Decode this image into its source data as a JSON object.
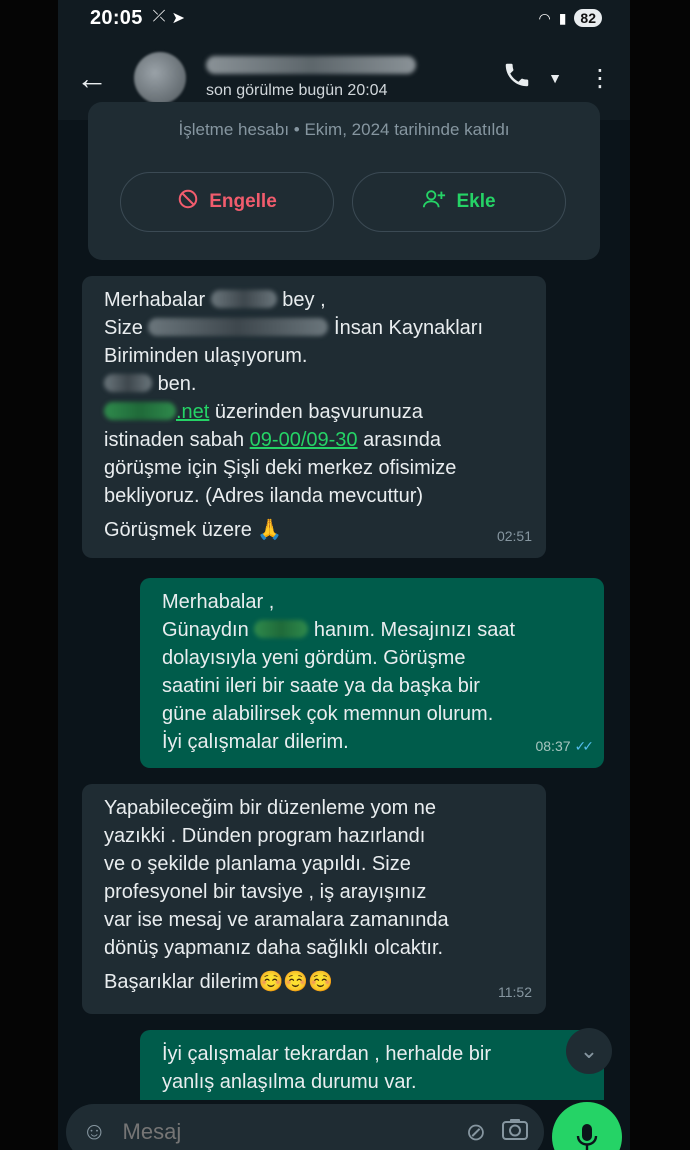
{
  "status_bar": {
    "time": "20:05",
    "battery": "82"
  },
  "header": {
    "status": "son görülme bugün 20:04"
  },
  "business_card": {
    "info": "İşletme hesabı • Ekim, 2024 tarihinde katıldı",
    "block_label": "Engelle",
    "add_label": "Ekle"
  },
  "messages": [
    {
      "direction": "incoming",
      "lines": {
        "l1a": "Merhabalar",
        "l1b": "bey ,",
        "l2a": "Size",
        "l2b": "İnsan Kaynakları",
        "l3": "Biriminden ulaşıyorum.",
        "l4": "ben.",
        "l5link": ".net",
        "l5rest": " üzerinden başvurunuza",
        "l6a": "istinaden sabah ",
        "l6link": "09-00/09-30",
        "l6b": " arasında",
        "l7": "görüşme için Şişli deki merkez ofisimize",
        "l8": "bekliyoruz. (Adres ilanda mevcuttur)",
        "l9": "Görüşmek üzere 🙏"
      },
      "time": "02:51"
    },
    {
      "direction": "outgoing",
      "lines": {
        "l1": "Merhabalar ,",
        "l2a": "Günaydın",
        "l2b": "hanım. Mesajınızı saat",
        "l3": "dolayısıyla yeni gördüm. Görüşme",
        "l4": "saatini ileri bir saate ya da başka bir",
        "l5": "güne alabilirsek çok memnun olurum.",
        "l6": "İyi çalışmalar dilerim."
      },
      "time": "08:37",
      "read": true
    },
    {
      "direction": "incoming",
      "lines": {
        "l1": "Yapabileceğim bir düzenleme yom ne",
        "l2": "yazıkki . Dünden program hazırlandı",
        "l3": "ve o şekilde planlama yapıldı. Size",
        "l4": "profesyonel bir tavsiye , iş arayışınız",
        "l5": "var ise mesaj ve aramalara zamanında",
        "l6": "dönüş yapmanız daha sağlıklı olcaktır.",
        "l7": "Başarıklar dilerim☺️☺️☺️"
      },
      "time": "11:52"
    },
    {
      "direction": "outgoing",
      "lines": {
        "l1": "İyi çalışmalar tekrardan , herhalde bir",
        "l2": "yanlış anlaşılma durumu var."
      }
    }
  ],
  "input": {
    "placeholder": "Mesaj"
  },
  "colors": {
    "chat_bg": "#0b141a",
    "incoming": "#1f2c33",
    "outgoing": "#005c4b",
    "accent": "#25d366",
    "danger": "#f15c6d",
    "link": "#53bdeb"
  }
}
